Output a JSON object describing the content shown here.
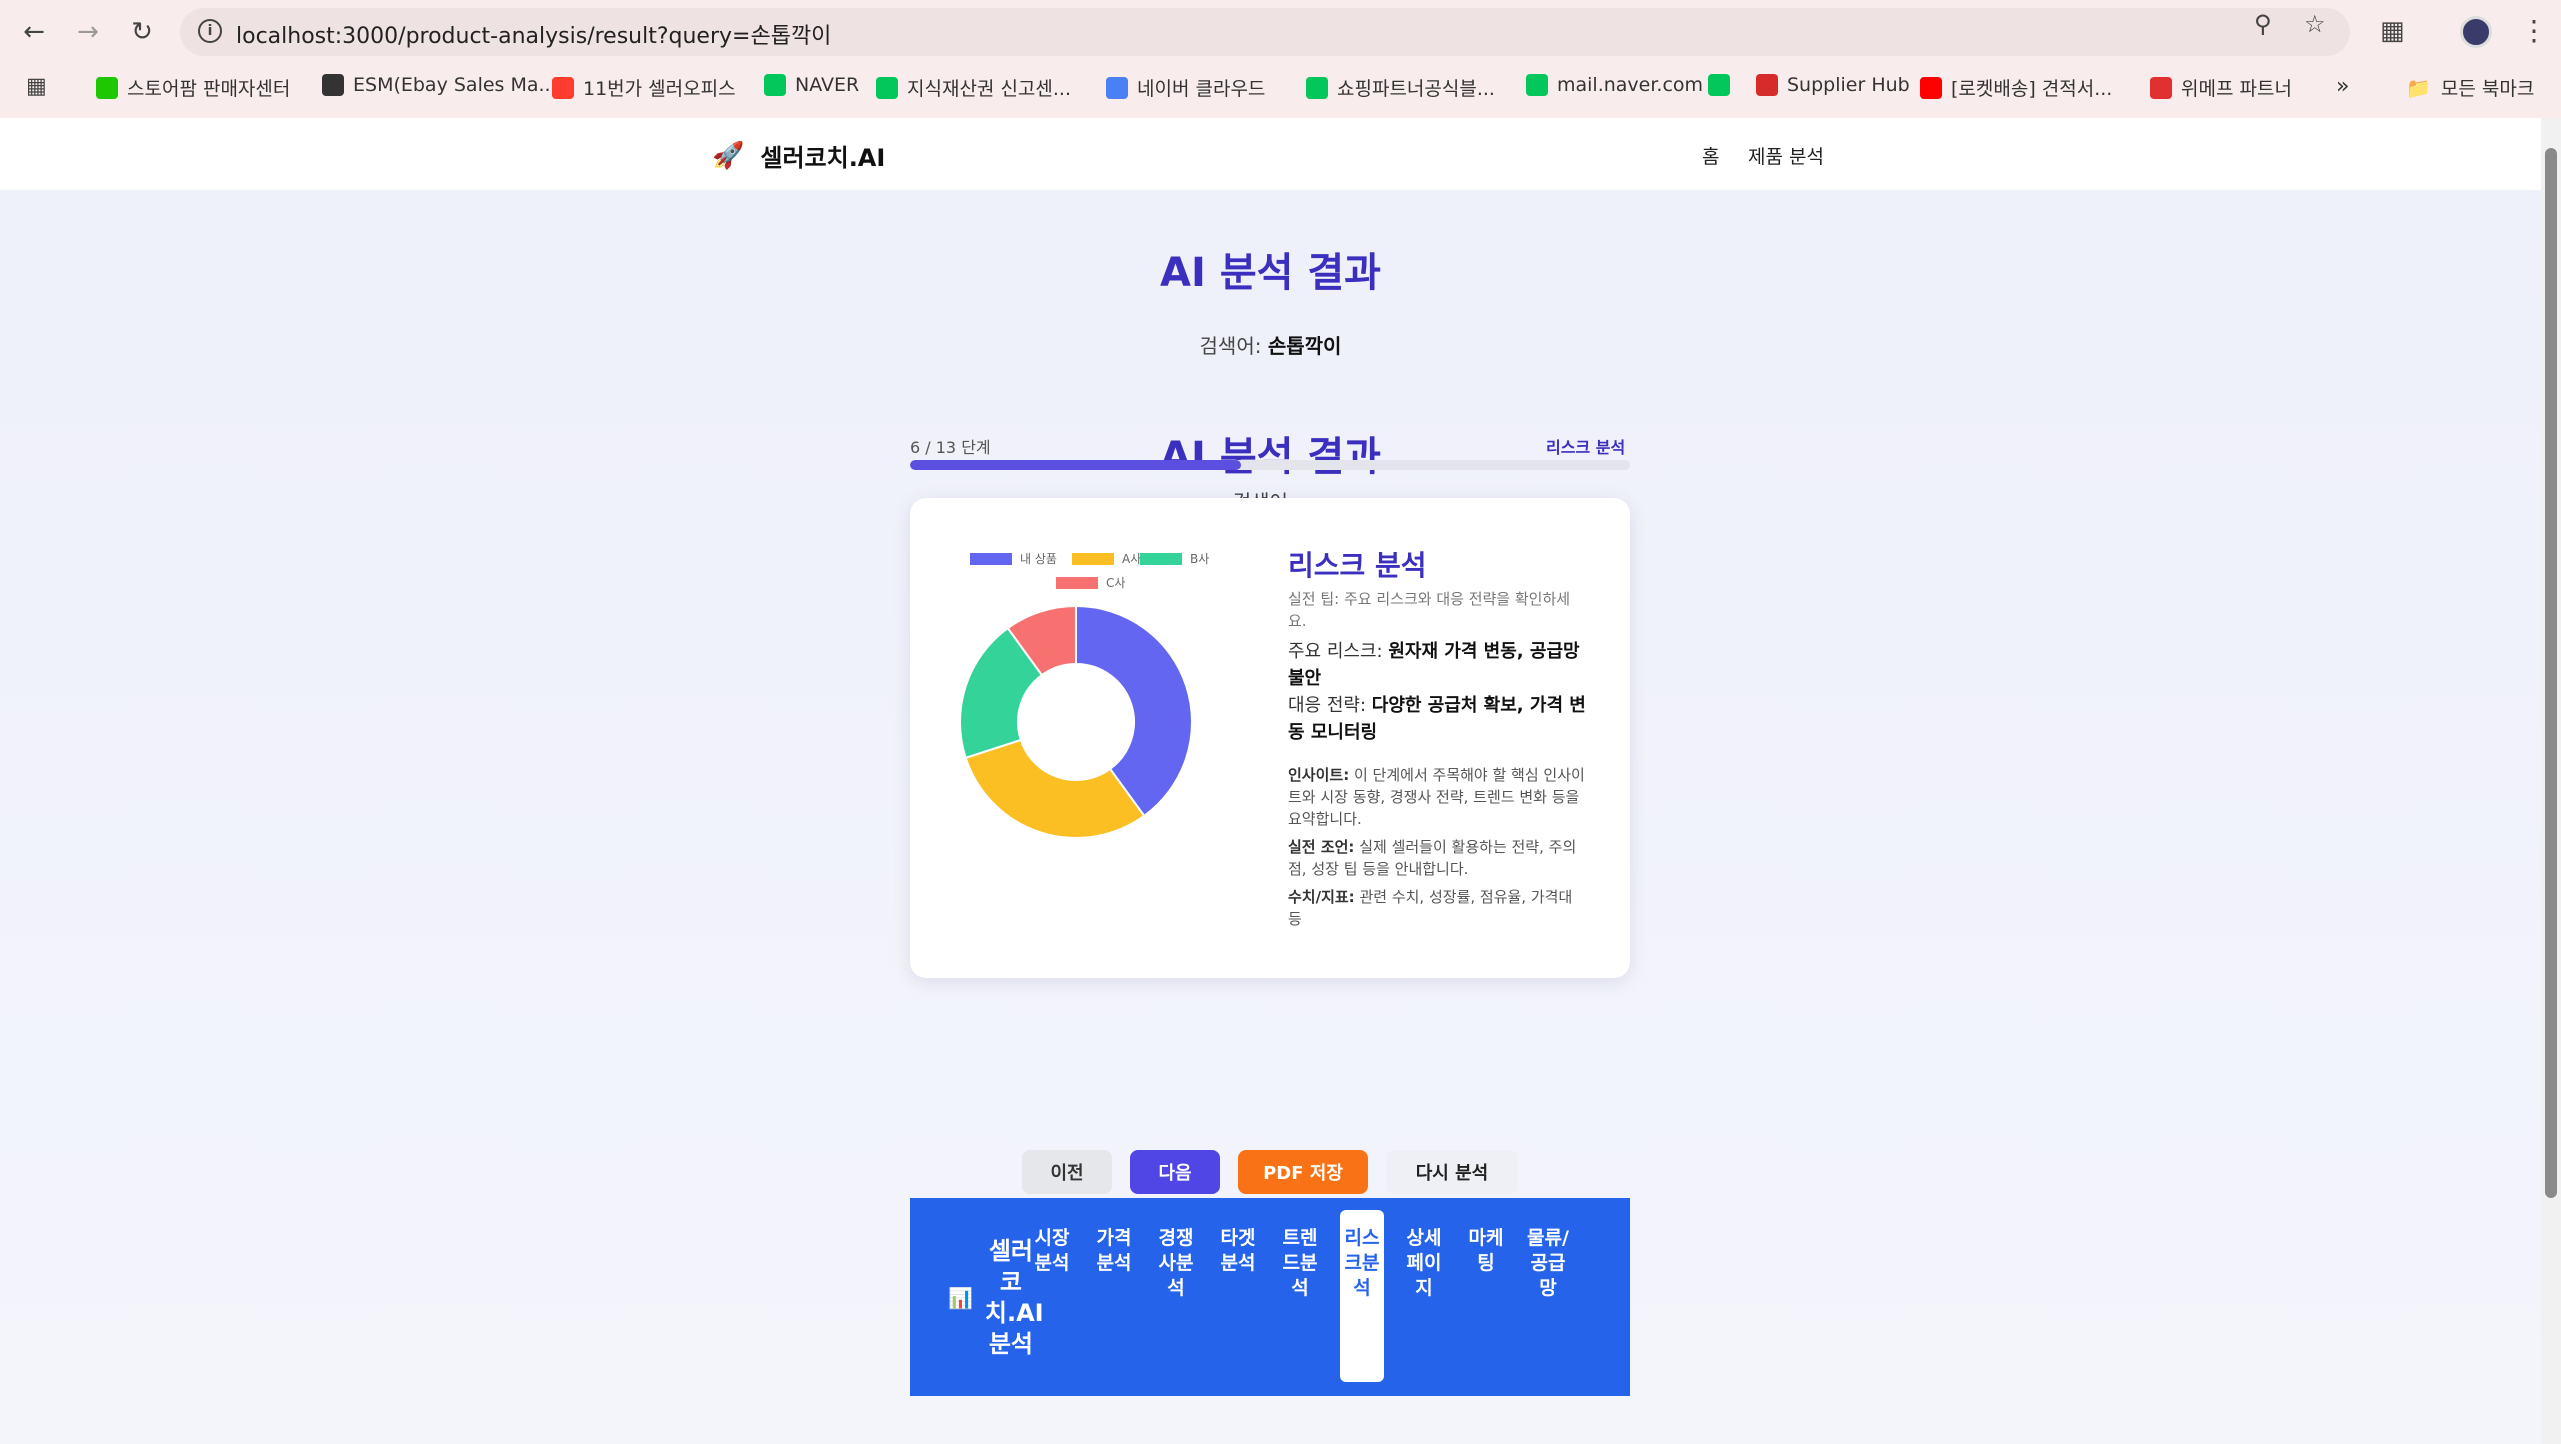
{
  "browser": {
    "url": "localhost:3000/product-analysis/result?query=손톱깍이",
    "bookmarks": [
      {
        "label": "스토어팜 판매자센터",
        "icon": "naver-smartstore-icon",
        "color": "#1ec800"
      },
      {
        "label": "ESM(Ebay Sales Ma...",
        "icon": "globe-icon",
        "color": "#333333"
      },
      {
        "label": "11번가 셀러오피스",
        "icon": "11st-icon",
        "color": "#ff3c2f"
      },
      {
        "label": "NAVER",
        "icon": "naver-icon",
        "color": "#03c75a"
      },
      {
        "label": "지식재산권 신고센...",
        "icon": "naver-icon",
        "color": "#03c75a"
      },
      {
        "label": "네이버 클라우드",
        "icon": "cloud-icon",
        "color": "#4a7ff5"
      },
      {
        "label": "쇼핑파트너공식블...",
        "icon": "blog-icon",
        "color": "#03c75a"
      },
      {
        "label": "mail.naver.com",
        "icon": "naver-icon",
        "color": "#03c75a"
      },
      {
        "label": "",
        "icon": "naver-icon",
        "color": "#03c75a"
      },
      {
        "label": "Supplier Hub",
        "icon": "coupang-icon",
        "color": "#d62b2b"
      },
      {
        "label": "[로켓배송] 견적서...",
        "icon": "youtube-icon",
        "color": "#ff0000"
      },
      {
        "label": "위메프 파트너",
        "icon": "wemakeprice-icon",
        "color": "#e0302f"
      }
    ],
    "more_label": "»",
    "all_bookmarks": "모든 북마크"
  },
  "site": {
    "logo_text": "셀러코치.AI",
    "nav": [
      "홈",
      "제품 분석"
    ]
  },
  "header": {
    "title": "AI 분석 결과",
    "query_label": "검색어:",
    "query_value": "손톱깍이"
  },
  "section": {
    "title": "AI 분석 결과",
    "query_text": "검색어: -"
  },
  "progress": {
    "text": "6 / 13 단계",
    "step_name": "리스크 분석",
    "current": 6,
    "total": 13,
    "fraction": 0.46
  },
  "card": {
    "title": "리스크 분석",
    "tip": "실전 팁: 주요 리스크와 대응 전략을 확인하세요.",
    "risk_label": "주요 리스크:",
    "risk_value": "원자재 가격 변동, 공급망 불안",
    "strategy_label": "대응 전략:",
    "strategy_value": "다양한 공급처 확보, 가격 변동 모니터링",
    "insight_label": "인사이트:",
    "insight_text": "이 단계에서 주목해야 할 핵심 인사이트와 시장 동향, 경쟁사 전략, 트렌드 변화 등을 요약합니다.",
    "advice_label": "실전 조언:",
    "advice_text": "실제 셀러들이 활용하는 전략, 주의점, 성장 팁 등을 안내합니다.",
    "metrics_label": "수치/지표:",
    "metrics_text": "관련 수치, 성장률, 점유율, 가격대 등"
  },
  "chart_data": {
    "type": "pie",
    "variant": "doughnut",
    "legend_position": "top",
    "categories": [
      "내 상품",
      "A사",
      "B사",
      "C사"
    ],
    "values": [
      40,
      30,
      20,
      10
    ],
    "colors": [
      "#6366f1",
      "#fbbf24",
      "#34d399",
      "#f87171"
    ]
  },
  "buttons": {
    "prev": "이전",
    "next": "다음",
    "pdf": "PDF 저장",
    "retry": "다시 분석"
  },
  "bottom_nav": {
    "brand": "셀러코치.AI 분석",
    "items": [
      "시장분석",
      "가격분석",
      "경쟁사분석",
      "타겟분석",
      "트렌드분석",
      "리스크분석",
      "상세페이지",
      "마케팅",
      "물류/공급망"
    ],
    "active_index": 5
  }
}
